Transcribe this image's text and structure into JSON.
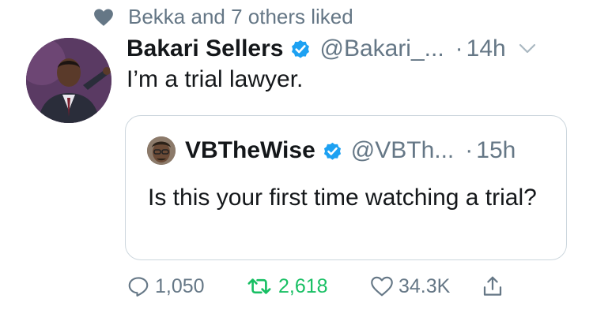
{
  "social_context": {
    "text": "Bekka and 7 others liked"
  },
  "tweet": {
    "display_name": "Bakari Sellers",
    "handle": "@Bakari_...",
    "time": "14h",
    "text": "I’m a trial lawyer."
  },
  "quote": {
    "display_name": "VBTheWise",
    "handle": "@VBTh...",
    "time": "15h",
    "text": "Is this your first time watching a trial?"
  },
  "actions": {
    "replies": "1,050",
    "retweets": "2,618",
    "likes": "34.3K"
  },
  "colors": {
    "muted": "#657786",
    "retweet_active": "#17bf63",
    "verified_blue": "#1da1f2",
    "border": "#ccd6dd"
  }
}
